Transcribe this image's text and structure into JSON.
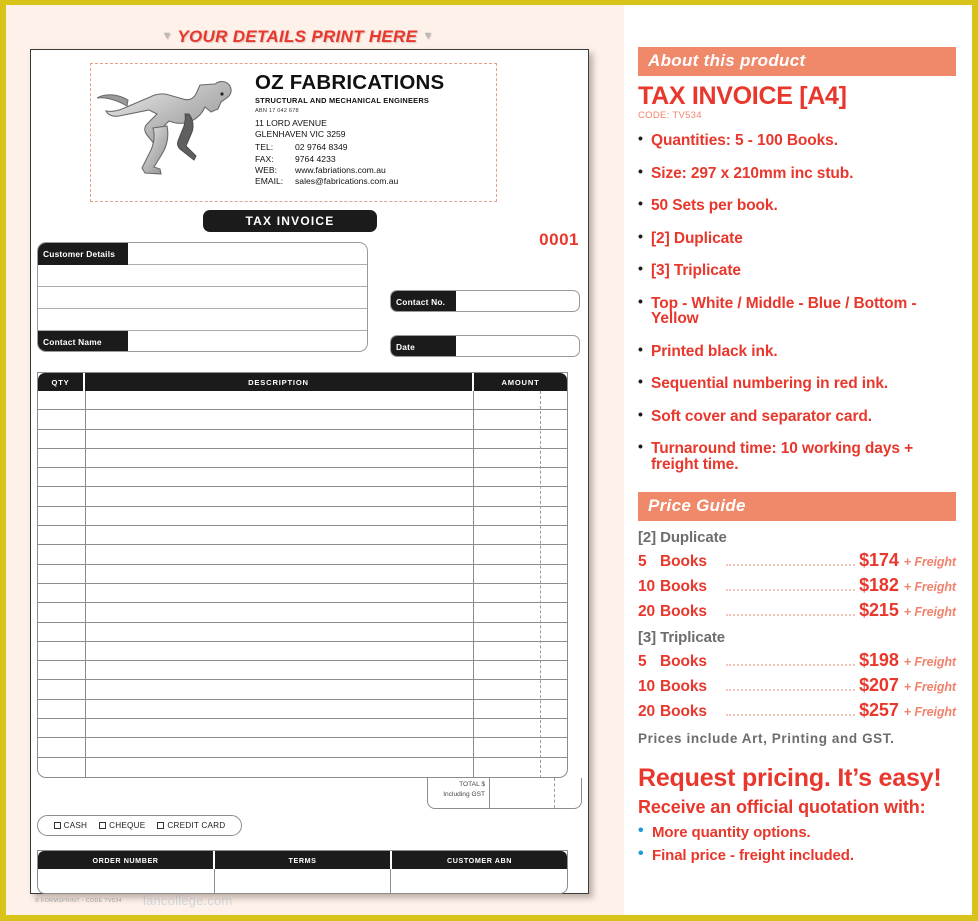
{
  "theme": {
    "border_color": "#d8c319",
    "accent_red": "#e8372c",
    "accent_salmon": "#f0886a",
    "grey_text": "#6d6d6d",
    "blue_bullet": "#1b9ad6"
  },
  "left": {
    "print_here_label": "YOUR DETAILS PRINT HERE",
    "caret_glyph": "▼",
    "letterhead": {
      "company_name": "OZ FABRICATIONS",
      "tagline": "STRUCTURAL AND MECHANICAL ENGINEERS",
      "abn": "ABN 17 042 678",
      "address_line1": "11 LORD AVENUE",
      "address_line2": "GLENHAVEN VIC 3259",
      "tel_label": "TEL:",
      "tel_value": "02 9764 8349",
      "fax_label": "FAX:",
      "fax_value": "9764 4233",
      "web_label": "WEB:",
      "web_value": "www.fabriations.com.au",
      "email_label": "EMAIL:",
      "email_value": "sales@fabrications.com.au"
    },
    "doc_type_pill": "TAX INVOICE",
    "serial_number": "0001",
    "customer_block": {
      "customer_details_label": "Customer Details",
      "contact_name_label": "Contact Name",
      "blank_rows": 3
    },
    "side_fields": [
      {
        "label": "Contact No.",
        "value": ""
      },
      {
        "label": "Date",
        "value": ""
      }
    ],
    "items_table": {
      "columns": [
        "QTY",
        "DESCRIPTION",
        "AMOUNT"
      ],
      "row_count": 20
    },
    "total_box": {
      "line1": "TOTAL $",
      "line2": "Including GST",
      "value": ""
    },
    "payment_options": [
      "CASH",
      "CHEQUE",
      "CREDIT CARD"
    ],
    "bottom_table": {
      "columns": [
        "ORDER NUMBER",
        "TERMS",
        "CUSTOMER ABN"
      ],
      "values": [
        "",
        "",
        ""
      ]
    },
    "imprint": "© FORMSPRINT - CODE TV534",
    "watermark": "lancollege.com"
  },
  "right": {
    "about_bar": "About this product",
    "product_title": "TAX INVOICE [A4]",
    "product_code": "CODE: TV534",
    "features": [
      "Quantities: 5 - 100 Books.",
      "Size: 297 x 210mm  inc stub.",
      "50 Sets per book.",
      "[2] Duplicate",
      "[3] Triplicate",
      "Top - White / Middle - Blue / Bottom - Yellow",
      "Printed black ink.",
      "Sequential numbering in red ink.",
      "Soft cover and separator card.",
      "Turnaround time: 10 working days + freight time."
    ],
    "price_bar": "Price Guide",
    "price_groups": [
      {
        "title": "[2] Duplicate",
        "rows": [
          {
            "qty": "5",
            "unit": "Books",
            "price": "$174",
            "freight": "+ Freight"
          },
          {
            "qty": "10",
            "unit": "Books",
            "price": "$182",
            "freight": "+ Freight"
          },
          {
            "qty": "20",
            "unit": "Books",
            "price": "$215",
            "freight": "+ Freight"
          }
        ]
      },
      {
        "title": "[3] Triplicate",
        "rows": [
          {
            "qty": "5",
            "unit": "Books",
            "price": "$198",
            "freight": "+ Freight"
          },
          {
            "qty": "10",
            "unit": "Books",
            "price": "$207",
            "freight": "+ Freight"
          },
          {
            "qty": "20",
            "unit": "Books",
            "price": "$257",
            "freight": "+ Freight"
          }
        ]
      }
    ],
    "prices_include": "Prices  include  Art,  Printing  and  GST.",
    "cta_headline": "Request pricing. It’s easy!",
    "cta_subhead": "Receive an official quotation with:",
    "cta_bullets": [
      "More quantity options.",
      "Final price - freight included."
    ]
  }
}
